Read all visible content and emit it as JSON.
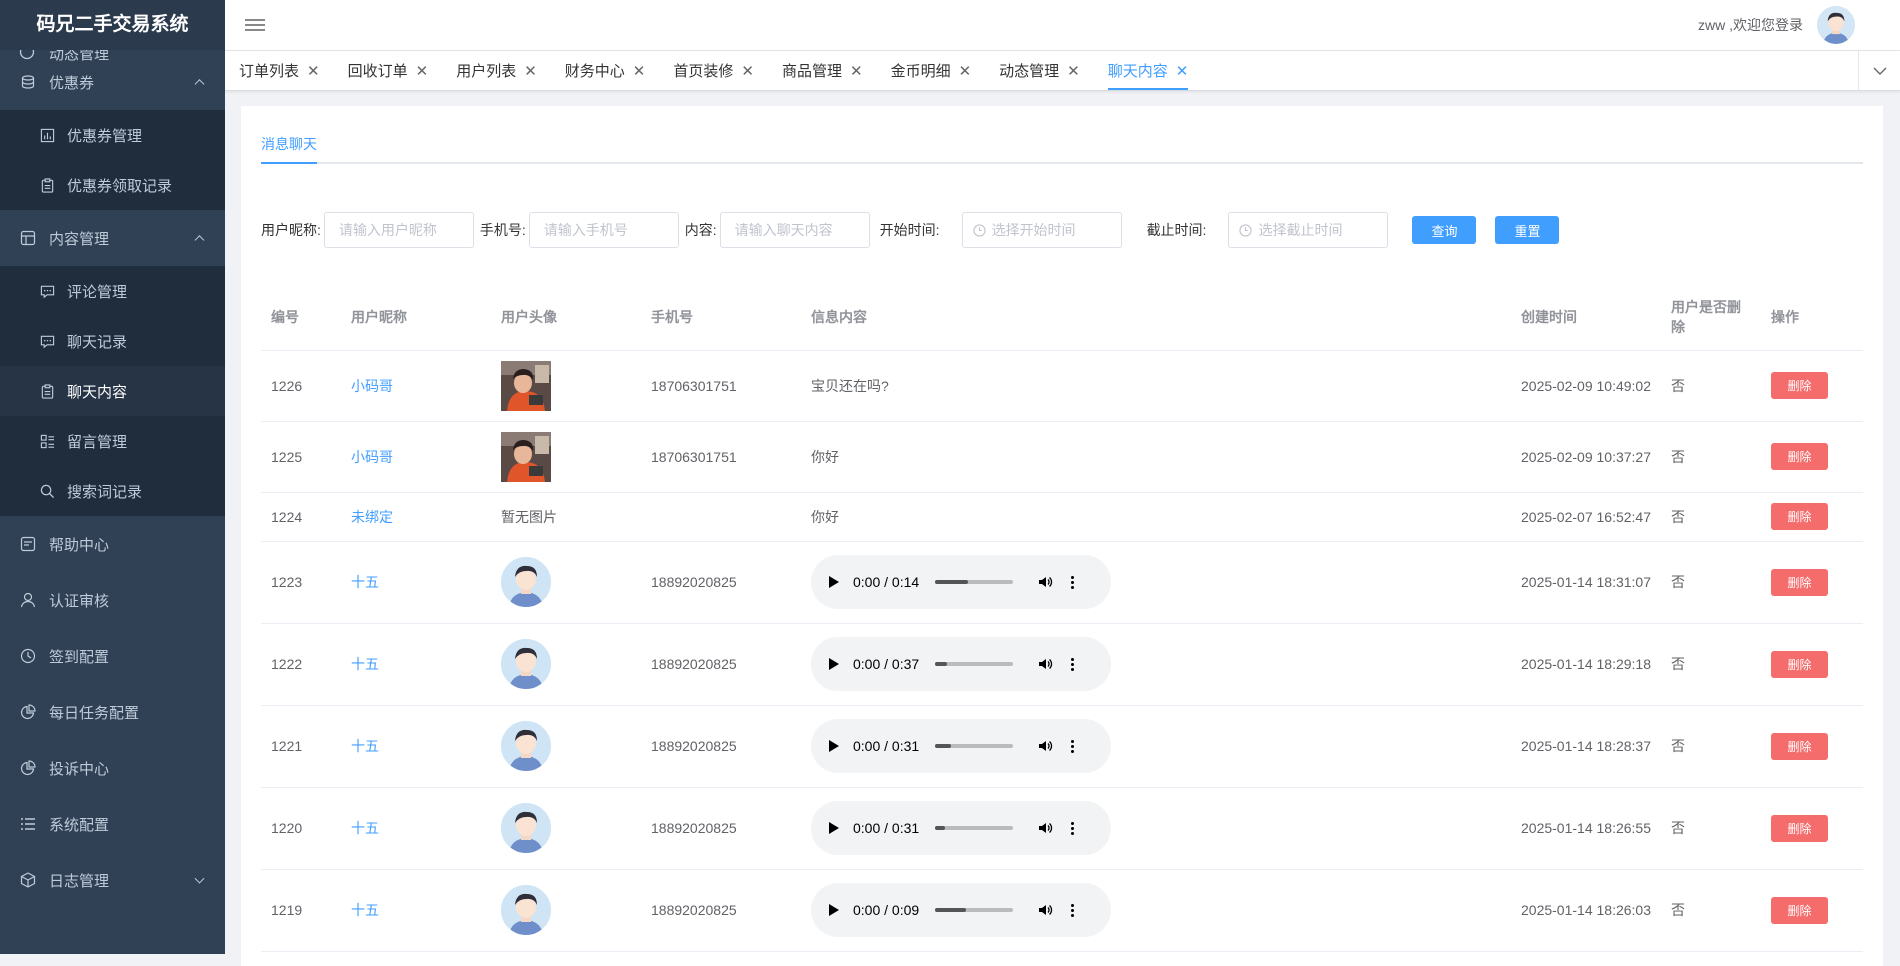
{
  "app": {
    "title": "码兄二手交易系统"
  },
  "sidebar": {
    "partial_label": "动态管理",
    "groups": [
      {
        "label": "优惠券",
        "icon": "coins-icon",
        "expanded": true,
        "items": [
          {
            "label": "优惠券管理",
            "icon": "chart-icon"
          },
          {
            "label": "优惠券领取记录",
            "icon": "clipboard-icon"
          }
        ]
      },
      {
        "label": "内容管理",
        "icon": "table-icon",
        "expanded": true,
        "items": [
          {
            "label": "评论管理",
            "icon": "comment-icon"
          },
          {
            "label": "聊天记录",
            "icon": "chat-icon"
          },
          {
            "label": "聊天内容",
            "icon": "clipboard-icon",
            "active": true
          },
          {
            "label": "留言管理",
            "icon": "list-icon"
          },
          {
            "label": "搜索词记录",
            "icon": "search-icon"
          }
        ]
      }
    ],
    "items": [
      {
        "label": "帮助中心",
        "icon": "help-icon"
      },
      {
        "label": "认证审核",
        "icon": "user-icon"
      },
      {
        "label": "签到配置",
        "icon": "clock-icon"
      },
      {
        "label": "每日任务配置",
        "icon": "pie-icon"
      },
      {
        "label": "投诉中心",
        "icon": "pie-icon"
      },
      {
        "label": "系统配置",
        "icon": "settings-list-icon"
      },
      {
        "label": "日志管理",
        "icon": "box-icon"
      }
    ]
  },
  "navbar": {
    "welcome": "zww ,欢迎您登录"
  },
  "tags": [
    "订单列表",
    "回收订单",
    "用户列表",
    "财务中心",
    "首页装修",
    "商品管理",
    "金币明细",
    "动态管理",
    "聊天内容"
  ],
  "active_tag": "聊天内容",
  "tab": {
    "label": "消息聊天"
  },
  "filters": {
    "nickname_label": "用户昵称:",
    "nickname_placeholder": "请输入用户昵称",
    "phone_label": "手机号:",
    "phone_placeholder": "请输入手机号",
    "content_label": "内容:",
    "content_placeholder": "请输入聊天内容",
    "start_label": "开始时间:",
    "start_placeholder": "选择开始时间",
    "end_label": "截止时间:",
    "end_placeholder": "选择截止时间",
    "query_btn": "查询",
    "reset_btn": "重置"
  },
  "table": {
    "headers": [
      "编号",
      "用户昵称",
      "用户头像",
      "手机号",
      "信息内容",
      "创建时间",
      "用户是否删除",
      "操作"
    ],
    "delete_label": "删除",
    "rows": [
      {
        "id": "1226",
        "nickname": "小码哥",
        "avatar": "photo",
        "phone": "18706301751",
        "content_type": "text",
        "content": "宝贝还在吗?",
        "created": "2025-02-09 10:49:02",
        "deleted": "否"
      },
      {
        "id": "1225",
        "nickname": "小码哥",
        "avatar": "photo",
        "phone": "18706301751",
        "content_type": "text",
        "content": "你好",
        "created": "2025-02-09 10:37:27",
        "deleted": "否"
      },
      {
        "id": "1224",
        "nickname": "未绑定",
        "avatar": "none",
        "avatar_text": "暂无图片",
        "phone": "",
        "content_type": "text",
        "content": "你好",
        "created": "2025-02-07 16:52:47",
        "deleted": "否"
      },
      {
        "id": "1223",
        "nickname": "十五",
        "avatar": "default",
        "phone": "18892020825",
        "content_type": "audio",
        "time": "0:00 / 0:14",
        "progress": 0.42,
        "created": "2025-01-14 18:31:07",
        "deleted": "否"
      },
      {
        "id": "1222",
        "nickname": "十五",
        "avatar": "default",
        "phone": "18892020825",
        "content_type": "audio",
        "time": "0:00 / 0:37",
        "progress": 0.15,
        "created": "2025-01-14 18:29:18",
        "deleted": "否"
      },
      {
        "id": "1221",
        "nickname": "十五",
        "avatar": "default",
        "phone": "18892020825",
        "content_type": "audio",
        "time": "0:00 / 0:31",
        "progress": 0.2,
        "created": "2025-01-14 18:28:37",
        "deleted": "否"
      },
      {
        "id": "1220",
        "nickname": "十五",
        "avatar": "default",
        "phone": "18892020825",
        "content_type": "audio",
        "time": "0:00 / 0:31",
        "progress": 0.12,
        "created": "2025-01-14 18:26:55",
        "deleted": "否"
      },
      {
        "id": "1219",
        "nickname": "十五",
        "avatar": "default",
        "phone": "18892020825",
        "content_type": "audio",
        "time": "0:00 / 0:09",
        "progress": 0.4,
        "created": "2025-01-14 18:26:03",
        "deleted": "否"
      }
    ]
  },
  "colors": {
    "primary": "#409eff",
    "danger": "#f56c6c",
    "sidebar": "#304156",
    "submenu": "#1f2d3d"
  }
}
